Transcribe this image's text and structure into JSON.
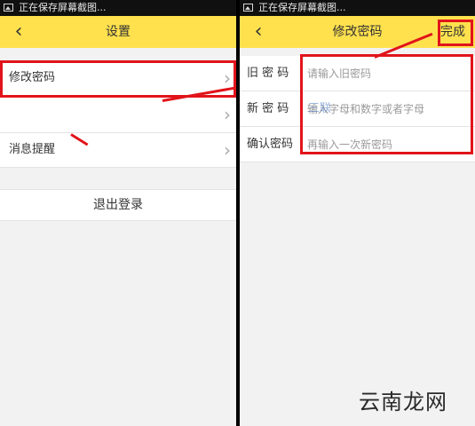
{
  "status_bar_text": "正在保存屏幕截图...",
  "left": {
    "title": "设置",
    "items": [
      "修改密码",
      "",
      "消息提醒"
    ],
    "logout_label": "退出登录"
  },
  "right": {
    "title": "修改密码",
    "done_label": "完成",
    "fields": [
      {
        "label": "旧 密 码",
        "placeholder": "请输入旧密码"
      },
      {
        "label": "新 密 码",
        "placeholder": "输入字母和数字或者字母"
      },
      {
        "label": "确认密码",
        "placeholder": "再输入一次新密码"
      }
    ]
  },
  "watermark_mid": "三联",
  "watermark_brand": "云南龙网",
  "colors": {
    "accent_yellow": "#ffe14d",
    "annotation_red": "#e1141b"
  }
}
